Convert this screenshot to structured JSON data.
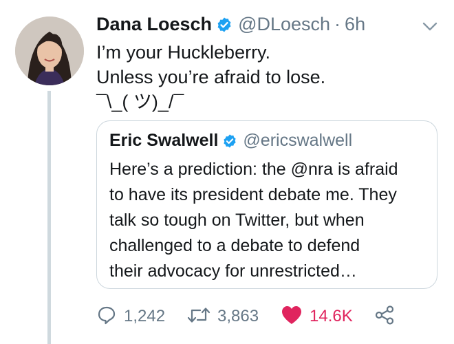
{
  "colors": {
    "text": "#14171a",
    "secondary": "#657786",
    "verified": "#1da1f2",
    "like": "#e0245e",
    "border": "#ccd6dd",
    "thread_line": "#cfd9de"
  },
  "tweet": {
    "author_name": "Dana Loesch",
    "handle": "@DLoesch",
    "separator": "·",
    "time": "6h",
    "lines": [
      "I’m your Huckleberry.",
      "Unless you’re afraid to lose.",
      "¯\\_( ツ)_/¯"
    ]
  },
  "quoted_tweet": {
    "author_name": "Eric Swalwell",
    "handle": "@ericswalwell",
    "lines": [
      "Here’s a prediction: the @nra is afraid",
      "to have its president debate me. They",
      "talk so tough on Twitter, but when",
      "challenged to a debate to defend",
      "their advocacy for unrestricted…"
    ]
  },
  "actions": {
    "replies": "1,242",
    "retweets": "3,863",
    "likes": "14.6K"
  },
  "icons": {
    "verified": "verified-badge-icon",
    "menu": "chevron-down-icon",
    "reply": "reply-icon",
    "retweet": "retweet-icon",
    "like": "heart-icon",
    "share": "share-icon"
  }
}
